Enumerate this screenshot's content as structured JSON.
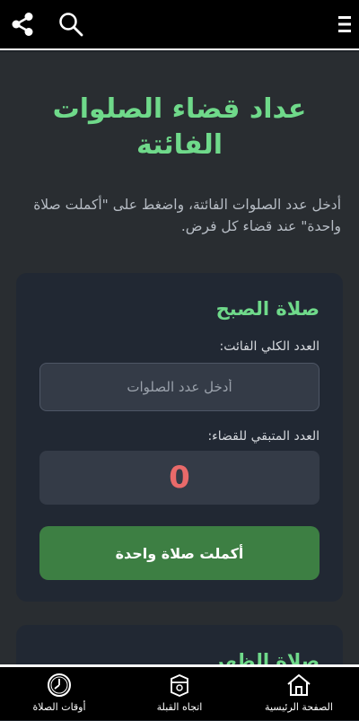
{
  "header": {
    "share_icon": "share-icon",
    "search_icon": "search-icon",
    "menu_icon": "menu-icon"
  },
  "page": {
    "title": "عداد قضاء الصلوات الفائتة",
    "intro": "أدخل عدد الصلوات الفائتة، واضغط على \"أكملت صلاة واحدة\" عند قضاء كل فرض."
  },
  "prayers": [
    {
      "name": "صلاة الصبح",
      "total_label": "العدد الكلي الفائت:",
      "total_placeholder": "أدخل عدد الصلوات",
      "total_value": "",
      "remaining_label": "العدد المتبقي للقضاء:",
      "remaining_value": "0",
      "complete_button": "أكملت صلاة واحدة"
    },
    {
      "name": "صلاة الظهر"
    }
  ],
  "bottom_nav": {
    "home": "الصفحة الرئيسية",
    "qibla": "اتجاه القبلة",
    "times": "أوقات الصلاة"
  },
  "colors": {
    "accent_green": "#6fd98a",
    "button_green": "#3d7f43",
    "remaining_red": "#e96a6a"
  }
}
